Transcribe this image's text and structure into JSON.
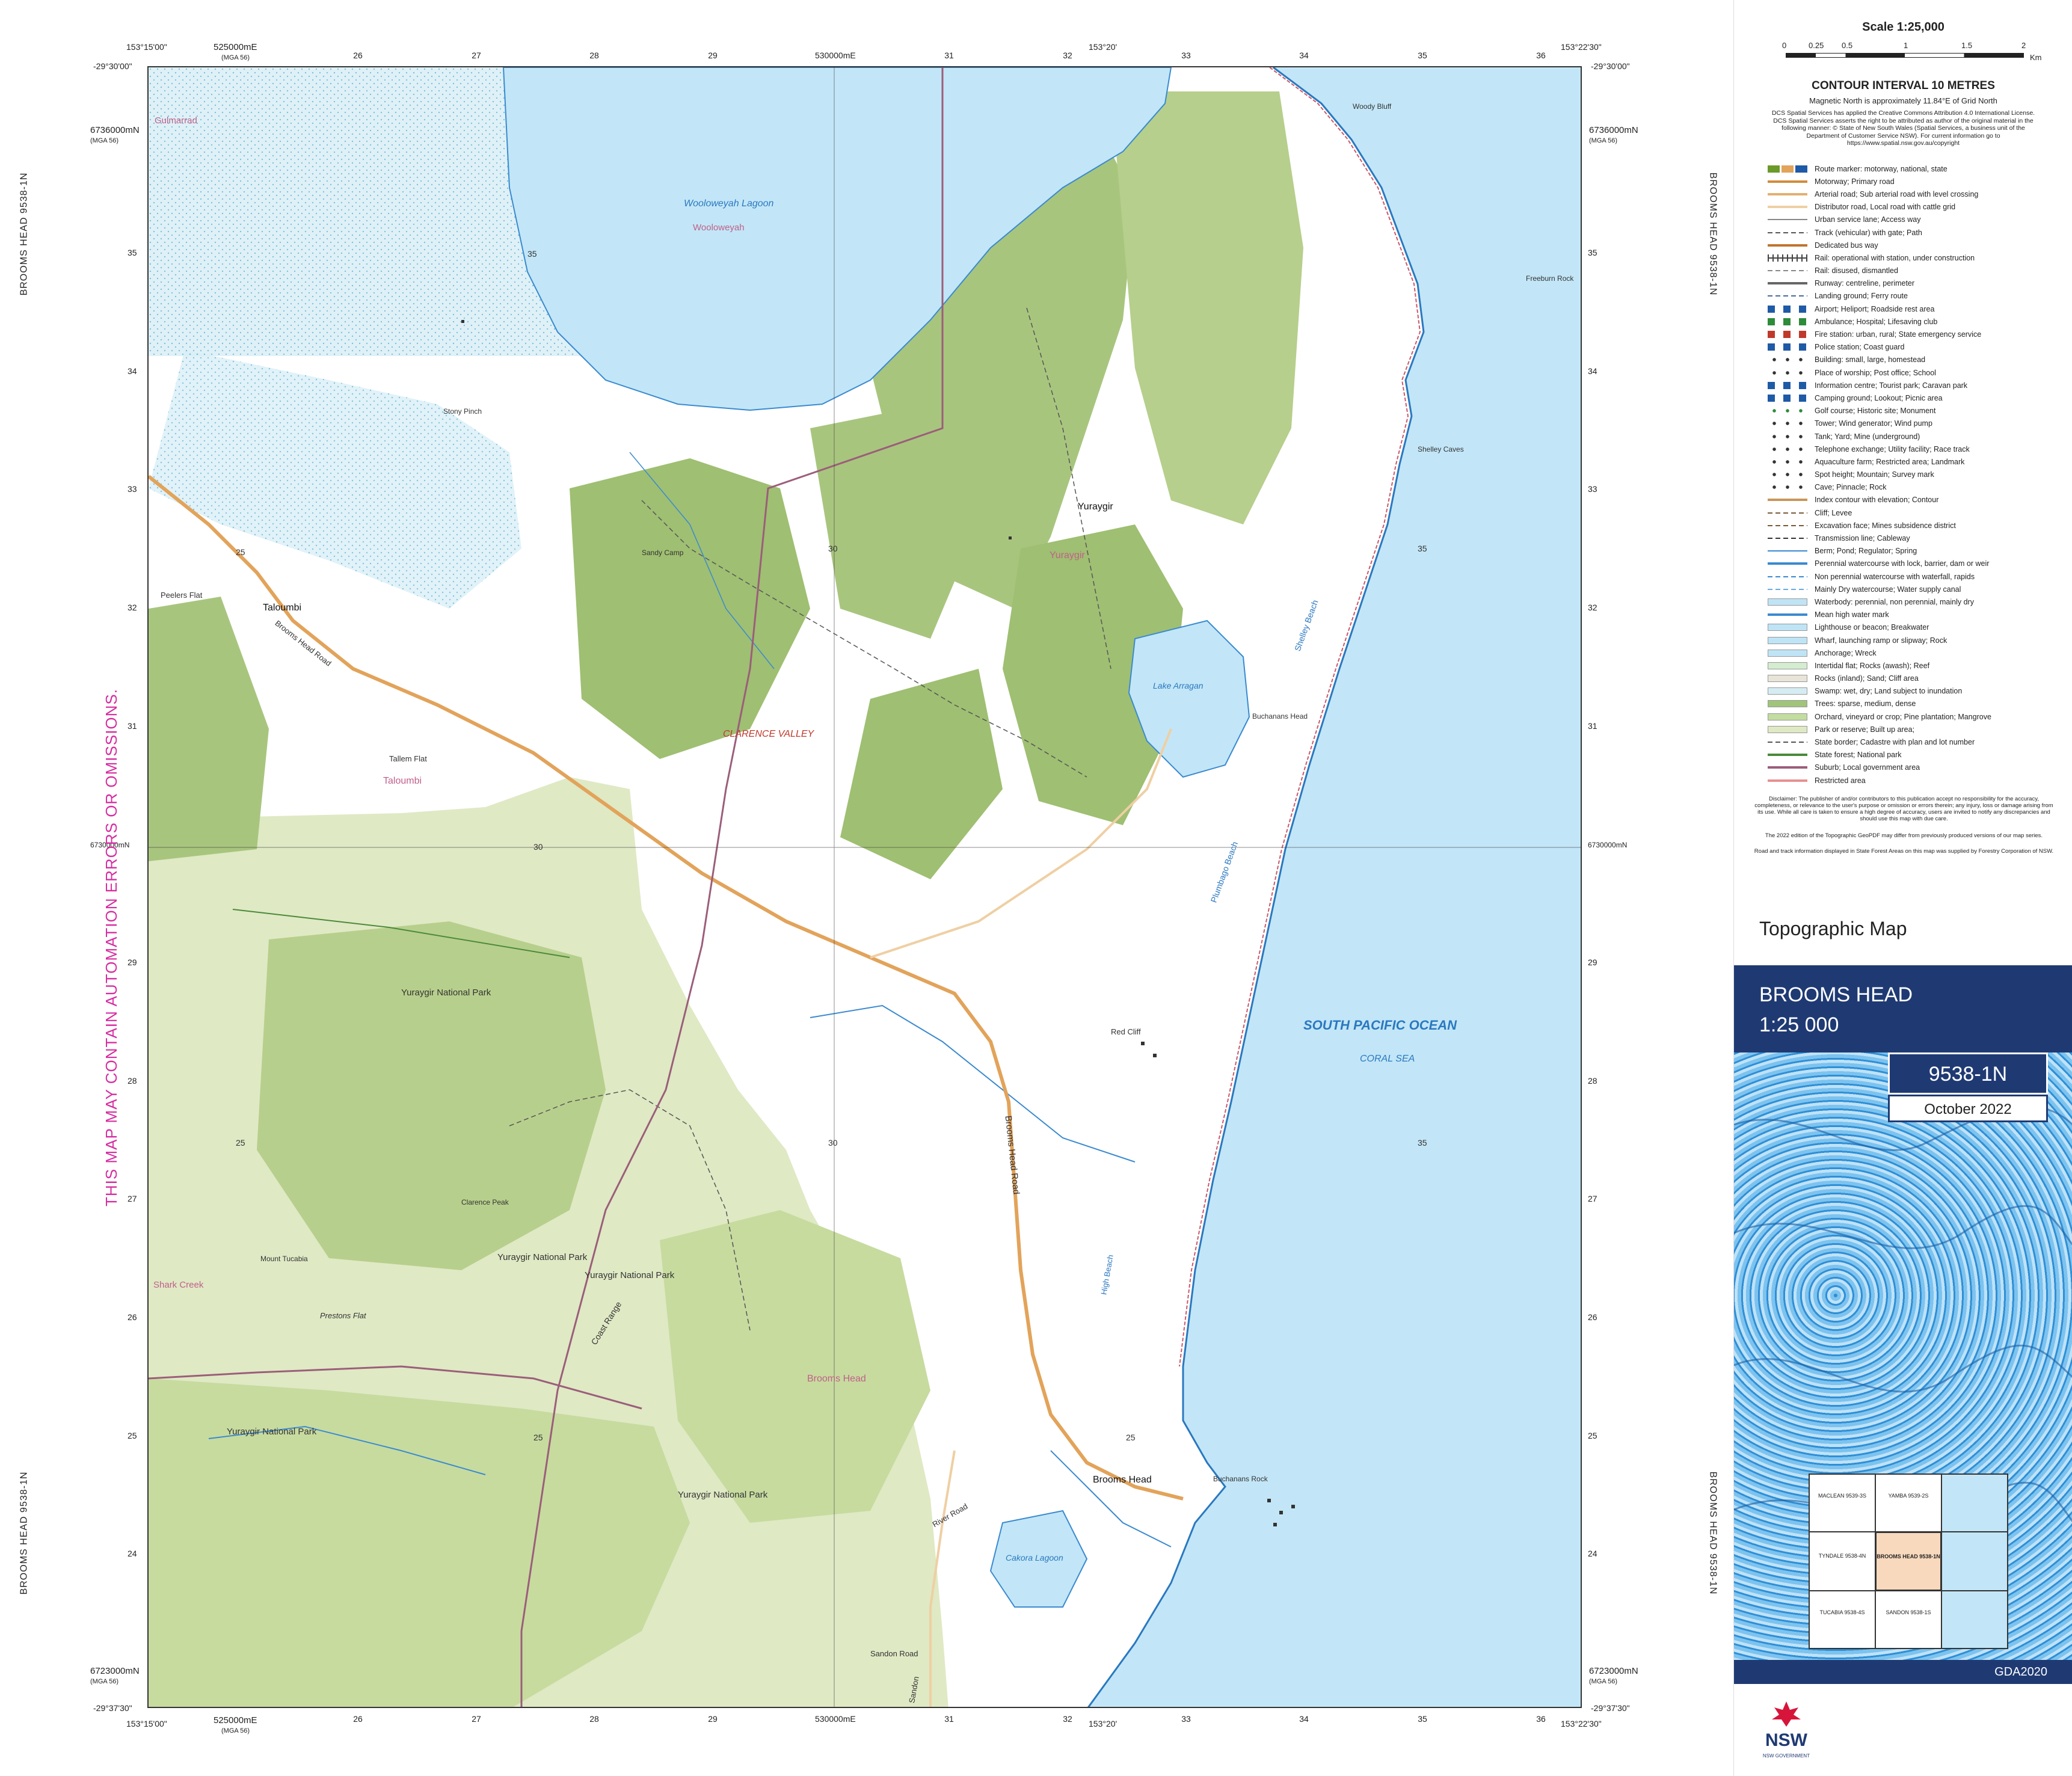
{
  "map": {
    "corner_tl": "-29°30'00\"",
    "corner_tr": "-29°30'00\"",
    "corner_bl": "-29°37'30\"",
    "corner_br": "-29°37'30\"",
    "lon_left_top": "153°15'00\"",
    "lon_right_top": "153°22'30\"",
    "lon_left_bottom": "153°15'00\"",
    "lon_right_bottom": "153°22'30\"",
    "lon_mid": "153°20'",
    "easting_first": "525000mE",
    "mga_tag": "(MGA 56)",
    "easting_mid": "530000mE",
    "top_ticks": [
      "26",
      "27",
      "28",
      "29",
      "31",
      "32",
      "33",
      "34",
      "35",
      "36"
    ],
    "bottom_ticks": [
      "26",
      "27",
      "28",
      "29",
      "31",
      "32",
      "33",
      "34",
      "35",
      "36"
    ],
    "northing_top": "6736000mN",
    "northing_mid": "6730000mN",
    "northing_bottom": "6723000mN",
    "side_ticks": [
      "35",
      "34",
      "33",
      "32",
      "31",
      "29",
      "28",
      "27",
      "26",
      "25",
      "24"
    ],
    "side_left_top": "BROOMS HEAD 9538-1N",
    "side_left_bottom": "BROOMS HEAD 9538-1N",
    "side_right_top": "BROOMS HEAD 9538-1N",
    "side_right_bottom": "BROOMS HEAD 9538-1N",
    "warning": "THIS MAP MAY CONTAIN AUTOMATION ERRORS OR OMISSIONS.",
    "labels": {
      "wooloweyah_lagoon": "Wooloweyah Lagoon",
      "wooloweyah": "Wooloweyah",
      "gulmarrad": "Gulmarrad",
      "taloumbi": "Taloumbi",
      "taloumbi_suburb": "Taloumbi",
      "peelers_flat": "Peelers Flat",
      "tallem_flat": "Tallem Flat",
      "clarence_valley": "CLARENCE VALLEY",
      "yuraygir": "Yuraygir",
      "yuraygir_suburb": "Yuraygir",
      "lake_arragan": "Lake Arragan",
      "shelley_beach": "Shelley Beach",
      "plumbago_beach": "Plumbago Beach",
      "south_pacific_ocean": "SOUTH PACIFIC OCEAN",
      "coral_sea": "CORAL SEA",
      "red_cliff": "Red Cliff",
      "brooms_head": "Brooms Head",
      "brooms_head_suburb": "Brooms Head",
      "brooms_head_road_1": "Brooms Head Road",
      "brooms_head_road_2": "Brooms Head Road",
      "cakora_lagoon": "Cakora Lagoon",
      "yuraygir_np_1": "Yuraygir National Park",
      "yuraygir_np_2": "Yuraygir National Park",
      "yuraygir_np_3": "Yuraygir National Park",
      "yuraygir_np_4": "Yuraygir National Park",
      "yuraygir_np_5": "Yuraygir National Park",
      "shark_creek": "Shark Creek",
      "prestons_flat": "Prestons Flat",
      "mount_tucabia": "Mount Tucabia",
      "woody_bluff": "Woody Bluff",
      "freeburn_rock": "Freeburn Rock",
      "shelley_caves": "Shelley Caves",
      "buchanans_head": "Buchanans Head",
      "buchanans_rock": "Buchanans Rock",
      "sandon": "Sandon",
      "sandy_camp": "Sandy Camp",
      "stony_pinch": "Stony Pinch",
      "coast_range": "Coast Range",
      "clarence_peak": "Clarence Peak",
      "high_beach": "High Beach",
      "river_road": "River Road",
      "sandon_road": "Sandon Road",
      "mid_30_a": "30",
      "mid_30_b": "30",
      "mid_30_c": "30",
      "mid_35_a": "35",
      "mid_35_b": "35",
      "mid_35_c": "35",
      "mid_25_a": "25",
      "mid_25_b": "25",
      "mid_25_c": "25",
      "mid_25_d": "25"
    }
  },
  "legend": {
    "scale_title": "Scale 1:25,000",
    "scale_ticks": [
      "0",
      "0.25",
      "0.5",
      "1",
      "1.5",
      "2"
    ],
    "scale_unit": "Km",
    "contour_interval": "CONTOUR INTERVAL 10 METRES",
    "magnetic_north": "Magnetic North is approximately 11.84°E of Grid North",
    "license_text": "DCS Spatial Services has applied the Creative Commons Attribution 4.0 International License. DCS Spatial Services asserts the right to be attributed as author of the original material in the following manner: © State of New South Wales (Spatial Services, a business unit of the Department of Customer Service NSW). For current information go to https://www.spatial.nsw.gov.au/copyright",
    "items": [
      {
        "label": "Route marker: motorway, national, state",
        "sym": "marker",
        "color": "#6a9a2a"
      },
      {
        "label": "Motorway; Primary road",
        "sym": "line",
        "color": "#d18b3a"
      },
      {
        "label": "Arterial road; Sub arterial road with level crossing",
        "sym": "line",
        "color": "#e2b072"
      },
      {
        "label": "Distributor road, Local road with cattle grid",
        "sym": "line",
        "color": "#efcfa3"
      },
      {
        "label": "Urban service lane; Access way",
        "sym": "thin",
        "color": "#888888"
      },
      {
        "label": "Track (vehicular) with gate; Path",
        "sym": "dash",
        "color": "#555555"
      },
      {
        "label": "Dedicated bus way",
        "sym": "line",
        "color": "#c0742e"
      },
      {
        "label": "Rail: operational with station, under construction",
        "sym": "rail",
        "color": "#444444"
      },
      {
        "label": "Rail: disused, dismantled",
        "sym": "dash",
        "color": "#888888"
      },
      {
        "label": "Runway: centreline, perimeter",
        "sym": "line",
        "color": "#666666"
      },
      {
        "label": "Landing ground; Ferry route",
        "sym": "dash",
        "color": "#4a6a9a"
      },
      {
        "label": "Airport; Heliport; Roadside rest area",
        "sym": "icons",
        "color": "#1f5aa6"
      },
      {
        "label": "Ambulance; Hospital; Lifesaving club",
        "sym": "icons",
        "color": "#2e8b3a"
      },
      {
        "label": "Fire station: urban, rural; State emergency service",
        "sym": "icons",
        "color": "#c0392b"
      },
      {
        "label": "Police station; Coast guard",
        "sym": "icons",
        "color": "#1f5aa6"
      },
      {
        "label": "Building: small, large, homestead",
        "sym": "dots",
        "color": "#333333"
      },
      {
        "label": "Place of worship; Post office; School",
        "sym": "dots",
        "color": "#333333"
      },
      {
        "label": "Information centre; Tourist park; Caravan park",
        "sym": "icons",
        "color": "#1f5aa6"
      },
      {
        "label": "Camping ground; Lookout; Picnic area",
        "sym": "icons",
        "color": "#1f5aa6"
      },
      {
        "label": "Golf course; Historic site; Monument",
        "sym": "dots",
        "color": "#2e8b3a"
      },
      {
        "label": "Tower; Wind generator; Wind pump",
        "sym": "dots",
        "color": "#333333"
      },
      {
        "label": "Tank; Yard; Mine (underground)",
        "sym": "dots",
        "color": "#333333"
      },
      {
        "label": "Telephone exchange; Utility facility; Race track",
        "sym": "dots",
        "color": "#333333"
      },
      {
        "label": "Aquaculture farm; Restricted area; Landmark",
        "sym": "dots",
        "color": "#333333"
      },
      {
        "label": "Spot height; Mountain; Survey mark",
        "sym": "dots",
        "color": "#333333"
      },
      {
        "label": "Cave; Pinnacle; Rock",
        "sym": "dots",
        "color": "#333333"
      },
      {
        "label": "Index contour with elevation; Contour",
        "sym": "line",
        "color": "#c8955a"
      },
      {
        "label": "Cliff; Levee",
        "sym": "dash",
        "color": "#7a5a3a"
      },
      {
        "label": "Excavation face; Mines subsidence district",
        "sym": "dash",
        "color": "#7a5a3a"
      },
      {
        "label": "Transmission line; Cableway",
        "sym": "dash",
        "color": "#333333"
      },
      {
        "label": "Berm; Pond; Regulator; Spring",
        "sym": "thin",
        "color": "#3a8ad0"
      },
      {
        "label": "Perennial watercourse with lock, barrier, dam or weir",
        "sym": "line",
        "color": "#3a8ad0"
      },
      {
        "label": "Non perennial watercourse with waterfall, rapids",
        "sym": "dash",
        "color": "#3a8ad0"
      },
      {
        "label": "Mainly Dry watercourse; Water supply canal",
        "sym": "dash",
        "color": "#6aaae0"
      },
      {
        "label": "Waterbody: perennial, non perennial, mainly dry",
        "sym": "fill",
        "color": "#bfe4f6"
      },
      {
        "label": "Mean high water mark",
        "sym": "line",
        "color": "#3a8ad0"
      },
      {
        "label": "Lighthouse or beacon; Breakwater",
        "sym": "fill",
        "color": "#bfe4f6"
      },
      {
        "label": "Wharf, launching ramp or slipway; Rock",
        "sym": "fill",
        "color": "#bfe4f6"
      },
      {
        "label": "Anchorage; Wreck",
        "sym": "fill",
        "color": "#bfe4f6"
      },
      {
        "label": "Intertidal flat; Rocks (awash); Reef",
        "sym": "fill",
        "color": "#d4eccf"
      },
      {
        "label": "Rocks (inland); Sand; Cliff area",
        "sym": "fill",
        "color": "#e8e4d8"
      },
      {
        "label": "Swamp: wet, dry; Land subject to inundation",
        "sym": "fill",
        "color": "#d6ecf3"
      },
      {
        "label": "Trees: sparse, medium, dense",
        "sym": "fill",
        "color": "#9fc47a"
      },
      {
        "label": "Orchard, vineyard or crop; Pine plantation; Mangrove",
        "sym": "fill",
        "color": "#c3dca0"
      },
      {
        "label": "Park or reserve; Built up area;",
        "sym": "fill",
        "color": "#dfe9c4"
      },
      {
        "label": "State border; Cadastre with plan and lot number",
        "sym": "dash",
        "color": "#555555"
      },
      {
        "label": "State forest; National park",
        "sym": "line",
        "color": "#4a8a3a"
      },
      {
        "label": "Suburb; Local government area",
        "sym": "line",
        "color": "#9b5e7a"
      },
      {
        "label": "Restricted area",
        "sym": "line",
        "color": "#e89090"
      }
    ],
    "disclaimer": "Disclaimer: The publisher of and/or contributors to this publication accept no responsibility for the accuracy, completeness, or relevance to the user's purpose or omission or errors therein; any injury, loss or damage arising from its use. While all care is taken to ensure a high degree of accuracy, users are invited to notify any discrepancies and should use this map with due care.",
    "edition_note": "The 2022 edition of the Topographic GeoPDF may differ from previously produced versions of our map series.",
    "forest_note": "Road and track information displayed in State Forest Areas on this map was supplied by Forestry Corporation of NSW.",
    "map_type": "Topographic Map",
    "title": "BROOMS HEAD",
    "scale_label": "1:25 000",
    "sheet_number": "9538-1N",
    "date": "October 2022",
    "index": {
      "nw": "MACLEAN 9539-3S",
      "n": "YAMBA 9539-2S",
      "w": "TYNDALE 9538-4N",
      "c": "BROOMS HEAD 9538-1N",
      "sw": "TUCABIA 9538-4S",
      "s": "SANDON 9538-1S"
    },
    "datum": "GDA2020",
    "logo_text": "NSW GOVERNMENT"
  }
}
